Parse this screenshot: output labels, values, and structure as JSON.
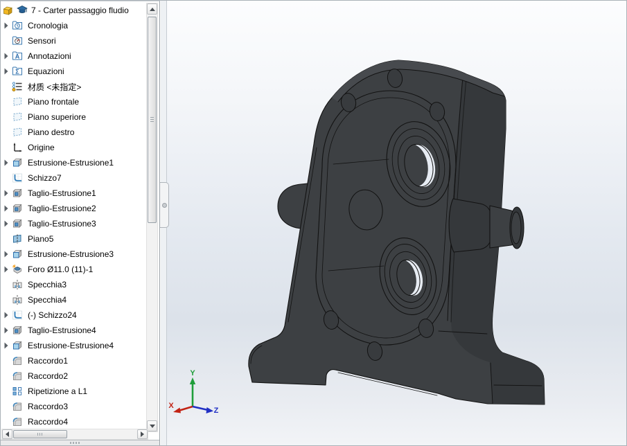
{
  "document": {
    "title": "7 - Carter passaggio fludio"
  },
  "tree": {
    "root": {
      "label": "7 - Carter passaggio fludio",
      "icons": [
        "part",
        "cap"
      ]
    },
    "items": [
      {
        "label": "Cronologia",
        "icon": "history-folder",
        "arrow": true
      },
      {
        "label": "Sensori",
        "icon": "sensors-folder",
        "arrow": false
      },
      {
        "label": "Annotazioni",
        "icon": "annotations-folder",
        "arrow": true
      },
      {
        "label": "Equazioni",
        "icon": "equations-folder",
        "arrow": true
      },
      {
        "label": "材质 <未指定>",
        "icon": "material",
        "arrow": false
      },
      {
        "label": "Piano frontale",
        "icon": "plane",
        "arrow": false
      },
      {
        "label": "Piano superiore",
        "icon": "plane",
        "arrow": false
      },
      {
        "label": "Piano destro",
        "icon": "plane",
        "arrow": false
      },
      {
        "label": "Origine",
        "icon": "origin",
        "arrow": false
      },
      {
        "label": "Estrusione-Estrusione1",
        "icon": "boss-extrude",
        "arrow": true
      },
      {
        "label": "Schizzo7",
        "icon": "sketch",
        "arrow": false
      },
      {
        "label": "Taglio-Estrusione1",
        "icon": "cut-extrude",
        "arrow": true
      },
      {
        "label": "Taglio-Estrusione2",
        "icon": "cut-extrude",
        "arrow": true
      },
      {
        "label": "Taglio-Estrusione3",
        "icon": "cut-extrude",
        "arrow": true
      },
      {
        "label": "Piano5",
        "icon": "ref-plane",
        "arrow": false
      },
      {
        "label": "Estrusione-Estrusione3",
        "icon": "boss-extrude",
        "arrow": true
      },
      {
        "label": "Foro Ø11.0 (11)-1",
        "icon": "hole-wizard",
        "arrow": true
      },
      {
        "label": "Specchia3",
        "icon": "mirror",
        "arrow": false
      },
      {
        "label": "Specchia4",
        "icon": "mirror",
        "arrow": false
      },
      {
        "label": "(-) Schizzo24",
        "icon": "sketch",
        "arrow": true
      },
      {
        "label": "Taglio-Estrusione4",
        "icon": "cut-extrude",
        "arrow": true
      },
      {
        "label": "Estrusione-Estrusione4",
        "icon": "boss-extrude",
        "arrow": true
      },
      {
        "label": "Raccordo1",
        "icon": "fillet",
        "arrow": false
      },
      {
        "label": "Raccordo2",
        "icon": "fillet",
        "arrow": false
      },
      {
        "label": "Ripetizione a L1",
        "icon": "linear-pattern",
        "arrow": false
      },
      {
        "label": "Raccordo3",
        "icon": "fillet",
        "arrow": false
      },
      {
        "label": "Raccordo4",
        "icon": "fillet",
        "arrow": false
      }
    ]
  },
  "viewport": {
    "triad": {
      "x": "X",
      "y": "Y",
      "z": "Z",
      "x_color": "#c22314",
      "y_color": "#1f9e3a",
      "z_color": "#2130c4"
    },
    "model": {
      "body_color": "#3d4043",
      "side_color": "#35383b",
      "top_color": "#474a4e",
      "edge_color": "#121212",
      "hole_light_color": "#e7ecf3"
    }
  }
}
